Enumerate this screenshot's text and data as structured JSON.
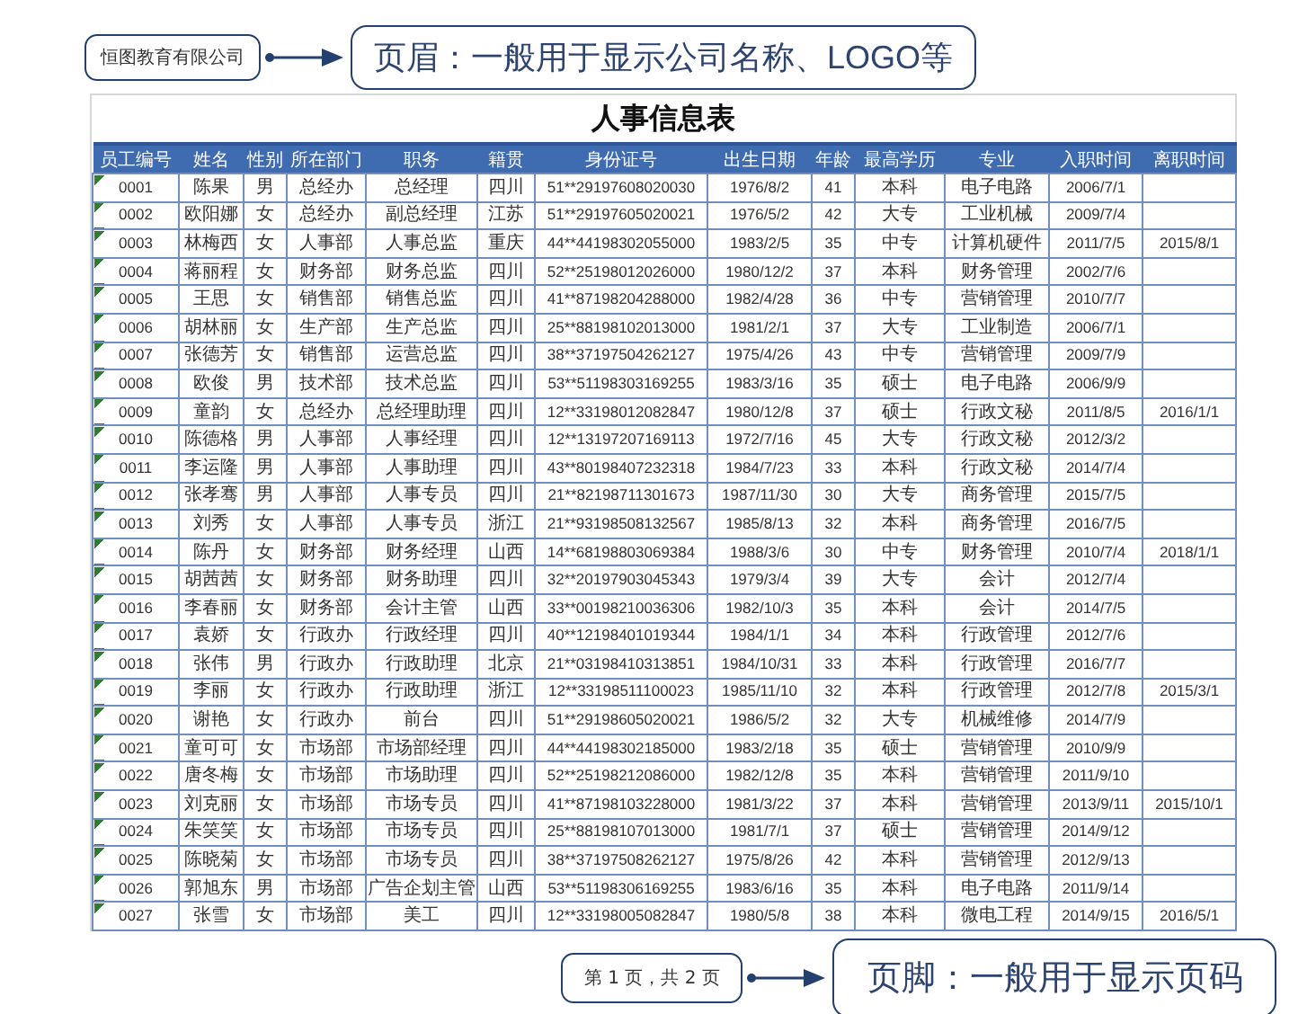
{
  "header": {
    "company": "恒图教育有限公司",
    "note": "页眉：一般用于显示公司名称、LOGO等"
  },
  "table": {
    "title": "人事信息表",
    "columns": [
      "员工编号",
      "姓名",
      "性别",
      "所在部门",
      "职务",
      "籍贯",
      "身份证号",
      "出生日期",
      "年龄",
      "最高学历",
      "专业",
      "入职时间",
      "离职时间"
    ],
    "rows": [
      [
        "0001",
        "陈果",
        "男",
        "总经办",
        "总经理",
        "四川",
        "51**29197608020030",
        "1976/8/2",
        "41",
        "本科",
        "电子电路",
        "2006/7/1"
      ],
      [
        "0002",
        "欧阳娜",
        "女",
        "总经办",
        "副总经理",
        "江苏",
        "51**29197605020021",
        "1976/5/2",
        "42",
        "大专",
        "工业机械",
        "2009/7/4"
      ],
      [
        "0003",
        "林梅西",
        "女",
        "人事部",
        "人事总监",
        "重庆",
        "44**44198302055000",
        "1983/2/5",
        "35",
        "中专",
        "计算机硬件",
        "2011/7/5",
        "2015/8/1"
      ],
      [
        "0004",
        "蒋丽程",
        "女",
        "财务部",
        "财务总监",
        "四川",
        "52**25198012026000",
        "1980/12/2",
        "37",
        "本科",
        "财务管理",
        "2002/7/6"
      ],
      [
        "0005",
        "王思",
        "女",
        "销售部",
        "销售总监",
        "四川",
        "41**87198204288000",
        "1982/4/28",
        "36",
        "中专",
        "营销管理",
        "2010/7/7"
      ],
      [
        "0006",
        "胡林丽",
        "女",
        "生产部",
        "生产总监",
        "四川",
        "25**88198102013000",
        "1981/2/1",
        "37",
        "大专",
        "工业制造",
        "2006/7/1"
      ],
      [
        "0007",
        "张德芳",
        "女",
        "销售部",
        "运营总监",
        "四川",
        "38**37197504262127",
        "1975/4/26",
        "43",
        "中专",
        "营销管理",
        "2009/7/9"
      ],
      [
        "0008",
        "欧俊",
        "男",
        "技术部",
        "技术总监",
        "四川",
        "53**51198303169255",
        "1983/3/16",
        "35",
        "硕士",
        "电子电路",
        "2006/9/9"
      ],
      [
        "0009",
        "童韵",
        "女",
        "总经办",
        "总经理助理",
        "四川",
        "12**33198012082847",
        "1980/12/8",
        "37",
        "硕士",
        "行政文秘",
        "2011/8/5",
        "2016/1/1"
      ],
      [
        "0010",
        "陈德格",
        "男",
        "人事部",
        "人事经理",
        "四川",
        "12**13197207169113",
        "1972/7/16",
        "45",
        "大专",
        "行政文秘",
        "2012/3/2"
      ],
      [
        "0011",
        "李运隆",
        "男",
        "人事部",
        "人事助理",
        "四川",
        "43**80198407232318",
        "1984/7/23",
        "33",
        "本科",
        "行政文秘",
        "2014/7/4"
      ],
      [
        "0012",
        "张孝骞",
        "男",
        "人事部",
        "人事专员",
        "四川",
        "21**82198711301673",
        "1987/11/30",
        "30",
        "大专",
        "商务管理",
        "2015/7/5"
      ],
      [
        "0013",
        "刘秀",
        "女",
        "人事部",
        "人事专员",
        "浙江",
        "21**93198508132567",
        "1985/8/13",
        "32",
        "本科",
        "商务管理",
        "2016/7/5"
      ],
      [
        "0014",
        "陈丹",
        "女",
        "财务部",
        "财务经理",
        "山西",
        "14**68198803069384",
        "1988/3/6",
        "30",
        "中专",
        "财务管理",
        "2010/7/4",
        "2018/1/1"
      ],
      [
        "0015",
        "胡茜茜",
        "女",
        "财务部",
        "财务助理",
        "四川",
        "32**20197903045343",
        "1979/3/4",
        "39",
        "大专",
        "会计",
        "2012/7/4"
      ],
      [
        "0016",
        "李春丽",
        "女",
        "财务部",
        "会计主管",
        "山西",
        "33**00198210036306",
        "1982/10/3",
        "35",
        "本科",
        "会计",
        "2014/7/5"
      ],
      [
        "0017",
        "袁娇",
        "女",
        "行政办",
        "行政经理",
        "四川",
        "40**12198401019344",
        "1984/1/1",
        "34",
        "本科",
        "行政管理",
        "2012/7/6"
      ],
      [
        "0018",
        "张伟",
        "男",
        "行政办",
        "行政助理",
        "北京",
        "21**03198410313851",
        "1984/10/31",
        "33",
        "本科",
        "行政管理",
        "2016/7/7"
      ],
      [
        "0019",
        "李丽",
        "女",
        "行政办",
        "行政助理",
        "浙江",
        "12**33198511100023",
        "1985/11/10",
        "32",
        "本科",
        "行政管理",
        "2012/7/8",
        "2015/3/1"
      ],
      [
        "0020",
        "谢艳",
        "女",
        "行政办",
        "前台",
        "四川",
        "51**29198605020021",
        "1986/5/2",
        "32",
        "大专",
        "机械维修",
        "2014/7/9"
      ],
      [
        "0021",
        "童可可",
        "女",
        "市场部",
        "市场部经理",
        "四川",
        "44**44198302185000",
        "1983/2/18",
        "35",
        "硕士",
        "营销管理",
        "2010/9/9"
      ],
      [
        "0022",
        "唐冬梅",
        "女",
        "市场部",
        "市场助理",
        "四川",
        "52**25198212086000",
        "1982/12/8",
        "35",
        "本科",
        "营销管理",
        "2011/9/10"
      ],
      [
        "0023",
        "刘克丽",
        "女",
        "市场部",
        "市场专员",
        "四川",
        "41**87198103228000",
        "1981/3/22",
        "37",
        "本科",
        "营销管理",
        "2013/9/11",
        "2015/10/1"
      ],
      [
        "0024",
        "朱笑笑",
        "女",
        "市场部",
        "市场专员",
        "四川",
        "25**88198107013000",
        "1981/7/1",
        "37",
        "硕士",
        "营销管理",
        "2014/9/12"
      ],
      [
        "0025",
        "陈晓菊",
        "女",
        "市场部",
        "市场专员",
        "四川",
        "38**37197508262127",
        "1975/8/26",
        "42",
        "本科",
        "营销管理",
        "2012/9/13"
      ],
      [
        "0026",
        "郭旭东",
        "男",
        "市场部",
        "广告企划主管",
        "山西",
        "53**51198306169255",
        "1983/6/16",
        "35",
        "本科",
        "电子电路",
        "2011/9/14"
      ],
      [
        "0027",
        "张雪",
        "女",
        "市场部",
        "美工",
        "四川",
        "12**33198005082847",
        "1980/5/8",
        "38",
        "本科",
        "微电工程",
        "2014/9/15",
        "2016/5/1"
      ]
    ]
  },
  "footer": {
    "page_label": "第 1 页，共 2 页",
    "note": "页脚：一般用于显示页码"
  }
}
